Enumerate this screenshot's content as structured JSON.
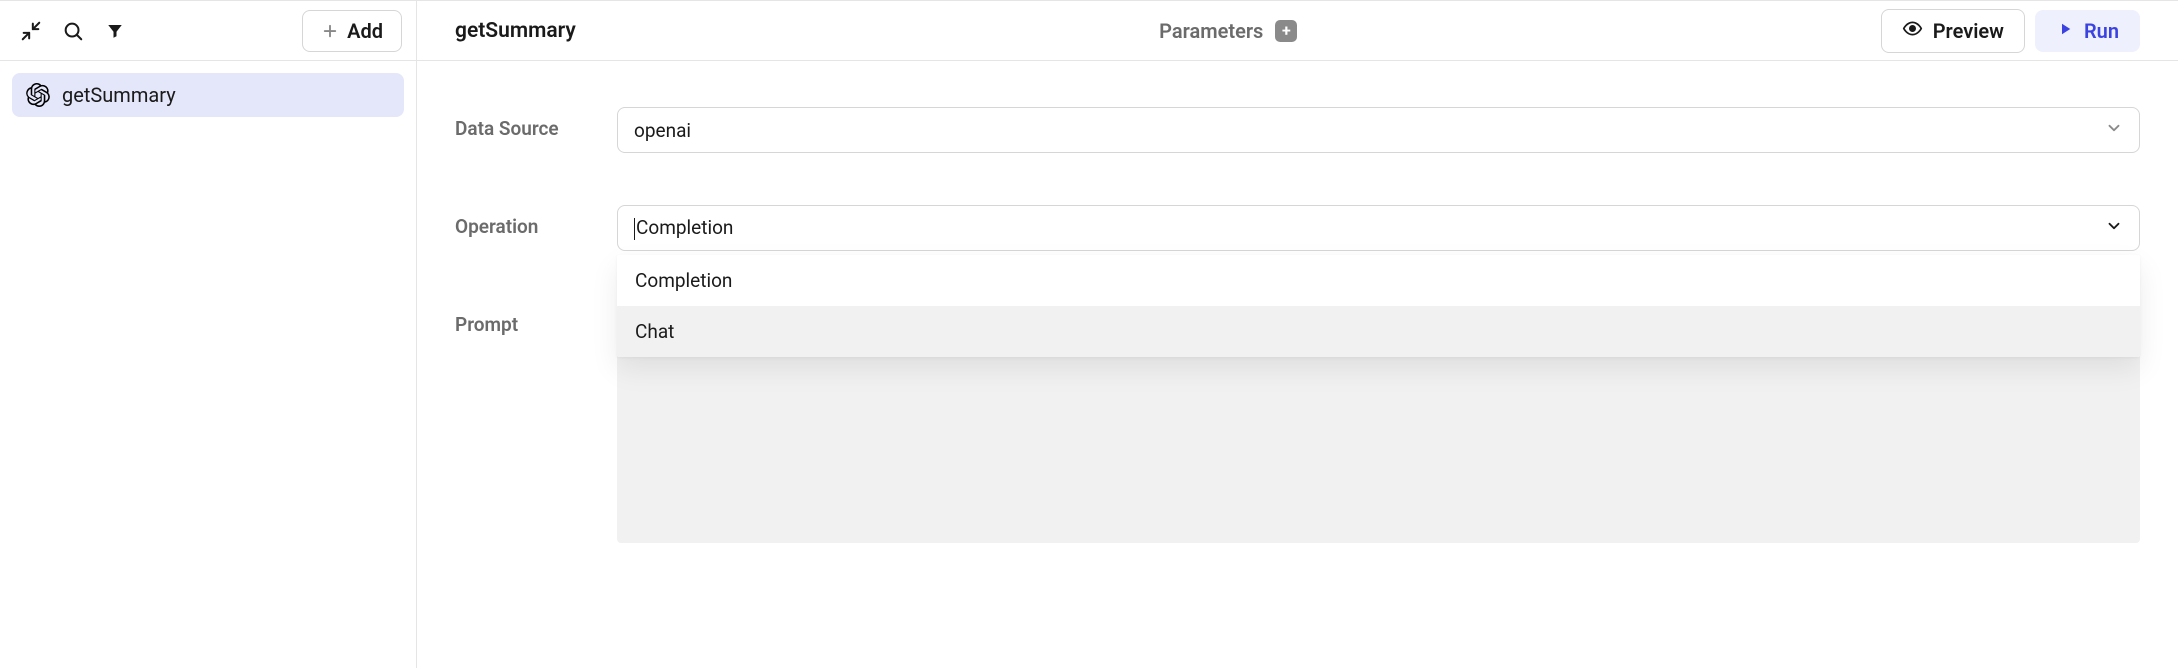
{
  "sidebar": {
    "add_label": "Add",
    "items": [
      {
        "label": "getSummary",
        "icon": "openai-icon"
      }
    ]
  },
  "header": {
    "title": "getSummary",
    "parameters_label": "Parameters",
    "preview_label": "Preview",
    "run_label": "Run"
  },
  "form": {
    "data_source": {
      "label": "Data Source",
      "value": "openai"
    },
    "operation": {
      "label": "Operation",
      "value": "Completion",
      "options": [
        "Completion",
        "Chat"
      ],
      "hovered_index": 1
    },
    "prompt": {
      "label": "Prompt"
    }
  }
}
